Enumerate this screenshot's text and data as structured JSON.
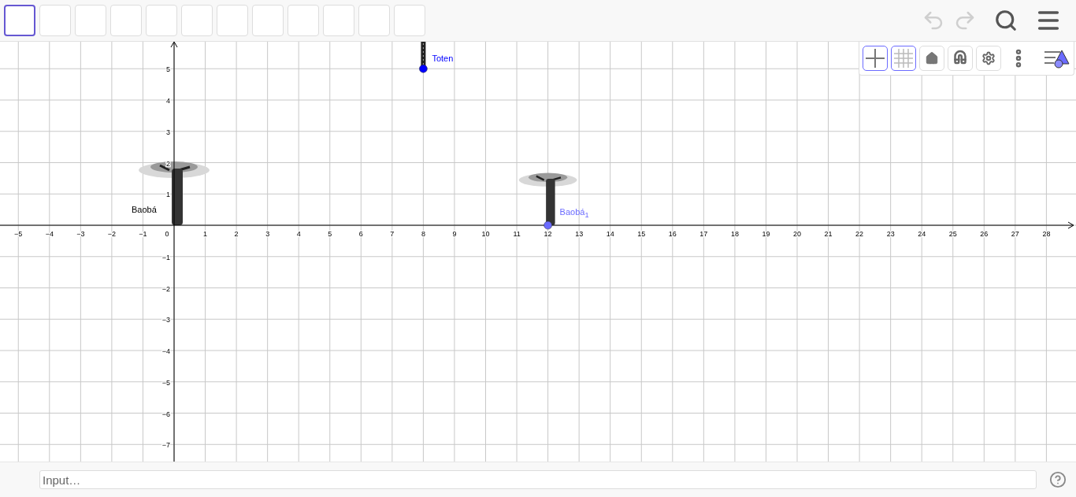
{
  "toolbar": {
    "tools": [
      {
        "selected": true
      },
      {
        "selected": false
      },
      {
        "selected": false
      },
      {
        "selected": false
      },
      {
        "selected": false
      },
      {
        "selected": false
      },
      {
        "selected": false
      },
      {
        "selected": false
      },
      {
        "selected": false
      },
      {
        "selected": false
      },
      {
        "selected": false
      },
      {
        "selected": false
      }
    ],
    "undo": {
      "disabled": true
    },
    "redo": {
      "disabled": true
    }
  },
  "style_bar": {
    "buttons": [
      {
        "kind": "axes",
        "selected": true
      },
      {
        "kind": "grid",
        "selected": true
      },
      {
        "kind": "home",
        "selected": false
      },
      {
        "kind": "magnet",
        "selected": false
      },
      {
        "kind": "settings",
        "selected": false
      },
      {
        "kind": "more"
      },
      {
        "kind": "toggle"
      }
    ]
  },
  "graphics": {
    "x_ticks": [
      "−5",
      "−4",
      "−3",
      "−2",
      "−1",
      "0",
      "1",
      "2",
      "3",
      "4",
      "5",
      "6",
      "7",
      "8",
      "9",
      "10",
      "11",
      "12",
      "13",
      "14",
      "15",
      "16",
      "17",
      "18",
      "19",
      "20",
      "21",
      "22",
      "23",
      "24",
      "25",
      "26",
      "27",
      "28"
    ],
    "y_ticks": [
      "5",
      "4",
      "3",
      "2",
      "1",
      "−1",
      "−2",
      "−3",
      "−4",
      "−5",
      "−6",
      "−7"
    ],
    "objects": [
      {
        "kind": "totem",
        "label": "Toten",
        "color": "#0000ff",
        "point": true
      },
      {
        "kind": "baobab",
        "label": "Baobá",
        "color": "#000000",
        "point": false
      },
      {
        "kind": "baobab",
        "label": "Baobá$_{1}$",
        "color": "#6b6bff",
        "point": true
      }
    ]
  },
  "input_bar": {
    "placeholder": "Input…"
  }
}
